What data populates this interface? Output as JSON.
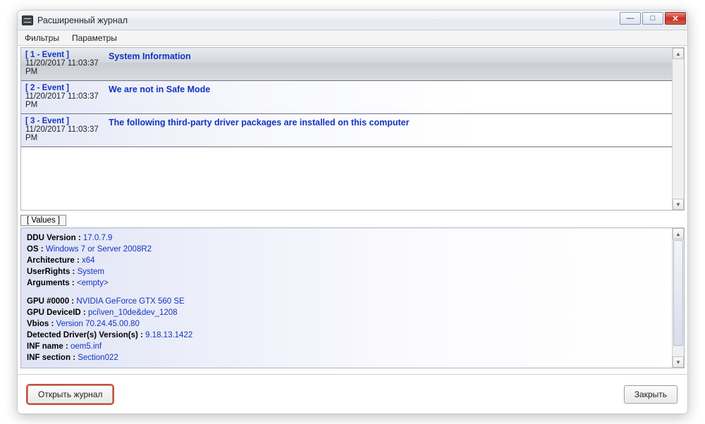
{
  "window": {
    "title": "Расширенный журнал"
  },
  "menu": {
    "filters": "Фильтры",
    "parameters": "Параметры"
  },
  "events": [
    {
      "tag": "[ 1 - Event ]",
      "time": "11/20/2017 11:03:37 PM",
      "message": "System Information",
      "selected": true
    },
    {
      "tag": "[ 2 - Event ]",
      "time": "11/20/2017 11:03:37 PM",
      "message": "We are not in Safe Mode",
      "selected": false
    },
    {
      "tag": "[ 3 - Event ]",
      "time": "11/20/2017 11:03:37 PM",
      "message": "The following third-party driver packages are installed on this computer",
      "selected": false
    }
  ],
  "values_label": "[ Values ]",
  "values": [
    {
      "k": "DDU Version :",
      "v": "17.0.7.9"
    },
    {
      "k": "OS :",
      "v": "Windows 7 or Server 2008R2"
    },
    {
      "k": "Architecture :",
      "v": "x64"
    },
    {
      "k": "UserRights :",
      "v": "System"
    },
    {
      "k": "Arguments :",
      "v": "<empty>"
    }
  ],
  "values2": [
    {
      "k": "GPU #0000 :",
      "v": "NVIDIA GeForce GTX 560 SE"
    },
    {
      "k": "GPU DeviceID :",
      "v": "pci\\ven_10de&dev_1208"
    },
    {
      "k": "Vbios :",
      "v": "Version 70.24.45.00.80"
    },
    {
      "k": "Detected Driver(s) Version(s) :",
      "v": "9.18.13.1422"
    },
    {
      "k": "INF name :",
      "v": "oem5.inf"
    },
    {
      "k": "INF section :",
      "v": "Section022"
    }
  ],
  "footer": {
    "open_log": "Открыть журнал",
    "close": "Закрыть"
  },
  "glyphs": {
    "minimize": "—",
    "maximize": "□",
    "close": "✕",
    "up": "▲",
    "down": "▼"
  }
}
